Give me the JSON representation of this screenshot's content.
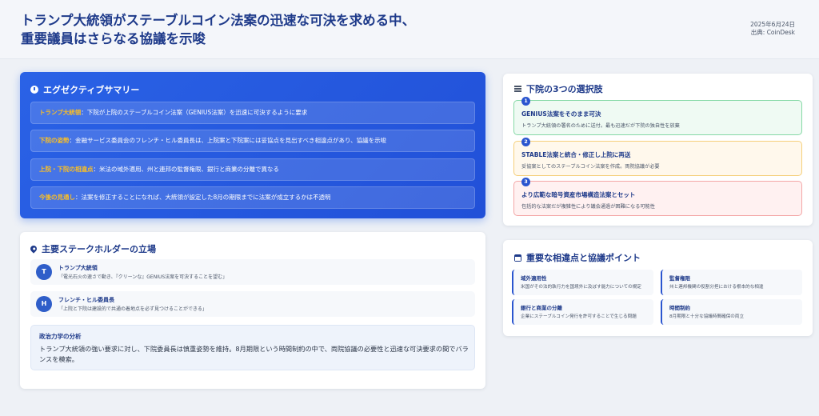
{
  "header": {
    "title_line1": "トランプ大統領がステーブルコイン法案の迅速な可決を求める中、",
    "title_line2": "重要議員はさらなる協議を示唆",
    "date": "2025年6月24日",
    "source": "出典: CoinDesk"
  },
  "executive_summary": {
    "title": "エグゼクティブサマリー",
    "icon": "clock-icon",
    "rows": [
      {
        "label": "トランプ大統領",
        "text": "：下院が上院のステーブルコイン法案（GENIUS法案）を迅速に可決するように要求"
      },
      {
        "label": "下院の姿勢",
        "text": "：金融サービス委員会のフレンチ・ヒル委員長は、上院案と下院案には妥協点を見出すべき相違点があり、協議を示唆"
      },
      {
        "label": "上院・下院の相違点",
        "text": "：米法の域外適用、州と連邦の監督権限、銀行と商業の分離で異なる"
      },
      {
        "label": "今後の見通し",
        "text": "：法案を修正することになれば、大統領が設定した8月の期限までに法案が成立するかは不透明"
      }
    ]
  },
  "stakeholders": {
    "title": "主要ステークホルダーの立場",
    "icon": "map-pin-icon",
    "people": [
      {
        "initial": "T",
        "name": "トランプ大統領",
        "desc": "「電光石火の速さで動き、『クリーンな』GENIUS法案を可決することを望む」"
      },
      {
        "initial": "H",
        "name": "フレンチ・ヒル委員長",
        "desc": "「上院と下院は建設的で共通の着地点を必ず見つけることができる」"
      }
    ],
    "analysis": {
      "heading": "政治力学の分析",
      "body": "トランプ大統領の強い要求に対し、下院委員長は慎重姿勢を維持。8月期限という時間制約の中で、両院協議の必要性と迅速な可決要求の間でバランスを模索。"
    }
  },
  "options": {
    "title": "下院の3つの選択肢",
    "icon": "list-icon",
    "items": [
      {
        "num": "1",
        "title": "GENIUS法案をそのまま可決",
        "desc": "トランプ大統領の署名のために送付。最も迅速だが下院の独自性を放棄"
      },
      {
        "num": "2",
        "title": "STABLE法案と統合・修正し上院に再送",
        "desc": "妥協案としてのステーブルコイン法案を作成。両院協議が必要"
      },
      {
        "num": "3",
        "title": "より広範な暗号資産市場構造法案とセット",
        "desc": "包括的な法案だが複雑性により議会通過が困難になる可能性"
      }
    ],
    "colors": {
      "green": "#86d9a6",
      "amber": "#f5cf7a",
      "red": "#f3a6a6"
    }
  },
  "differences": {
    "title": "重要な相違点と協議ポイント",
    "icon": "calendar-icon",
    "points": [
      {
        "title": "域外適用性",
        "desc": "米国がその法的執行力を国境外に及ぼす能力についての規定"
      },
      {
        "title": "監督権限",
        "desc": "州と連邦機関の役割分担における根本的な相違"
      },
      {
        "title": "銀行と商業の分離",
        "desc": "企業にステーブルコイン発行を許可することで生じる問題"
      },
      {
        "title": "時間制約",
        "desc": "8月期限と十分な協議時間確保の両立"
      }
    ]
  }
}
